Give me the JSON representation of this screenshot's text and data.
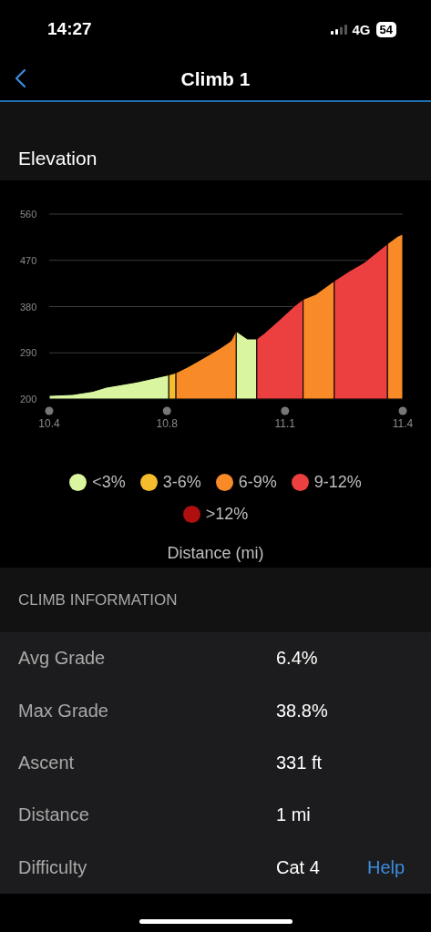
{
  "status_bar": {
    "time": "14:27",
    "network": "4G",
    "battery": "54"
  },
  "nav": {
    "title": "Climb 1"
  },
  "elevation": {
    "title": "Elevation",
    "chart_data": {
      "type": "area",
      "xlabel": "Distance (mi)",
      "x": [
        10.44,
        10.503,
        10.556,
        10.592,
        10.672,
        10.758,
        10.777,
        10.81,
        10.858,
        10.899,
        10.923,
        10.937,
        10.967,
        10.992,
        11.012,
        11.052,
        11.092,
        11.115,
        11.149,
        11.198,
        11.238,
        11.278,
        11.339,
        11.367,
        11.38
      ],
      "series": [
        {
          "name": "<3%",
          "color": "#d9f5a0",
          "values": [
            207,
            209,
            215,
            223,
            233,
            247,
            null,
            null,
            null,
            null,
            null,
            332,
            317,
            317,
            null,
            null,
            null,
            null,
            null,
            null,
            null,
            null,
            null,
            null,
            null
          ]
        },
        {
          "name": "3-6%",
          "color": "#f5bd2e",
          "values": [
            null,
            null,
            null,
            null,
            null,
            247,
            251,
            null,
            null,
            null,
            null,
            null,
            null,
            null,
            null,
            null,
            null,
            null,
            null,
            null,
            null,
            null,
            null,
            null,
            null
          ]
        },
        {
          "name": "6-9%",
          "color": "#f88a27",
          "values": [
            null,
            null,
            null,
            null,
            null,
            null,
            251,
            263,
            283,
            301,
            313,
            332,
            null,
            null,
            null,
            null,
            null,
            394,
            404,
            430,
            null,
            null,
            502,
            517,
            521
          ]
        },
        {
          "name": "9-12%",
          "color": "#ec3f3f",
          "values": [
            null,
            null,
            null,
            null,
            null,
            null,
            null,
            null,
            null,
            null,
            null,
            null,
            null,
            317,
            328,
            354,
            381,
            394,
            null,
            430,
            449,
            466,
            502,
            null,
            null
          ]
        },
        {
          "name": ">12%",
          "color": "#b00f0f",
          "values": [
            null,
            null,
            null,
            null,
            null,
            null,
            null,
            null,
            null,
            null,
            null,
            null,
            null,
            null,
            null,
            null,
            null,
            null,
            null,
            null,
            null,
            null,
            null,
            null,
            null
          ]
        }
      ],
      "xlim": [
        10.44,
        11.38
      ],
      "ylim": [
        200,
        560
      ],
      "grid": true,
      "xticks": [
        {
          "value": 10.44,
          "label": "10.4"
        },
        {
          "value": 10.753,
          "label": "10.8"
        },
        {
          "value": 11.067,
          "label": "11.1"
        },
        {
          "value": 11.38,
          "label": "11.4"
        }
      ],
      "yticks": [
        200,
        290,
        380,
        470,
        560
      ]
    }
  },
  "climb_information": {
    "title": "CLIMB INFORMATION",
    "rows": [
      {
        "label": "Avg Grade",
        "value": "6.4%"
      },
      {
        "label": "Max Grade",
        "value": "38.8%"
      },
      {
        "label": "Ascent",
        "value": "331 ft"
      },
      {
        "label": "Distance",
        "value": "1 mi"
      },
      {
        "label": "Difficulty",
        "value": "Cat 4",
        "link": "Help"
      }
    ]
  }
}
